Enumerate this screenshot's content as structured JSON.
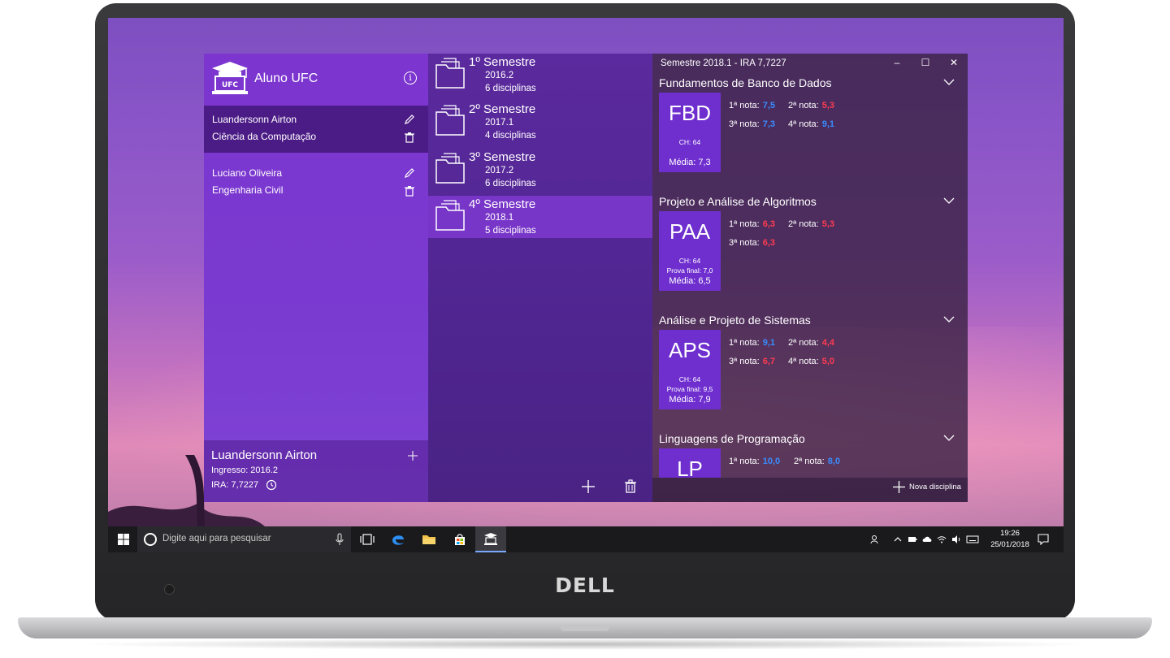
{
  "app": {
    "title": "Aluno UFC",
    "logo_text": "UFC"
  },
  "students": [
    {
      "name": "Luandersonn Airton",
      "course": "Ciência da Computação"
    },
    {
      "name": "Luciano Oliveira",
      "course": "Engenharia Civil"
    }
  ],
  "footer": {
    "name": "Luandersonn Airton",
    "ingresso": "Ingresso: 2016.2",
    "ira": "IRA: 7,7227"
  },
  "semesters": [
    {
      "title": "1º Semestre",
      "code": "2016.2",
      "count": "6 disciplinas"
    },
    {
      "title": "2º Semestre",
      "code": "2017.1",
      "count": "4 disciplinas"
    },
    {
      "title": "3º Semestre",
      "code": "2017.2",
      "count": "6 disciplinas"
    },
    {
      "title": "4º Semestre",
      "code": "2018.1",
      "count": "5 disciplinas"
    }
  ],
  "window": {
    "title": "Semestre 2018.1 - IRA 7,7227",
    "minimize": "–",
    "maximize": "☐",
    "close": "✕"
  },
  "disciplines": [
    {
      "title": "Fundamentos de Banco de Dados",
      "abbr": "FBD",
      "ch": "CH: 64",
      "final": "",
      "media": "Média: 7,3",
      "grades": [
        {
          "label": "1ª nota:",
          "value": "7,5",
          "color": "#3a8cff"
        },
        {
          "label": "2ª nota:",
          "value": "5,3",
          "color": "#ff3b52"
        },
        {
          "label": "3ª nota:",
          "value": "7,3",
          "color": "#3a8cff"
        },
        {
          "label": "4ª nota:",
          "value": "9,1",
          "color": "#3a8cff"
        }
      ]
    },
    {
      "title": "Projeto e Análise de Algoritmos",
      "abbr": "PAA",
      "ch": "CH: 64",
      "final": "Prova final: 7,0",
      "media": "Média: 6,5",
      "grades": [
        {
          "label": "1ª nota:",
          "value": "6,3",
          "color": "#ff3b52"
        },
        {
          "label": "2ª nota:",
          "value": "5,3",
          "color": "#ff3b52"
        },
        {
          "label": "3ª nota:",
          "value": "6,3",
          "color": "#ff3b52"
        }
      ]
    },
    {
      "title": "Análise e Projeto de Sistemas",
      "abbr": "APS",
      "ch": "CH: 64",
      "final": "Prova final: 9,5",
      "media": "Média: 7,9",
      "grades": [
        {
          "label": "1ª nota:",
          "value": "9,1",
          "color": "#3a8cff"
        },
        {
          "label": "2ª nota:",
          "value": "4,4",
          "color": "#ff3b52"
        },
        {
          "label": "3ª nota:",
          "value": "6,7",
          "color": "#ff3b52"
        },
        {
          "label": "4ª nota:",
          "value": "5,0",
          "color": "#ff3b52"
        }
      ]
    },
    {
      "title": "Linguagens de Programação",
      "abbr": "LP",
      "ch": "",
      "final": "",
      "media": "",
      "grades": [
        {
          "label": "1ª nota:",
          "value": "10,0",
          "color": "#3a8cff"
        },
        {
          "label": "2ª nota:",
          "value": "8,0",
          "color": "#3a8cff"
        }
      ]
    }
  ],
  "actions": {
    "new_discipline": "Nova disciplina"
  },
  "taskbar": {
    "search_placeholder": "Digite aqui para pesquisar",
    "time": "19:26",
    "date": "25/01/2018"
  },
  "device": {
    "brand": "DELL"
  },
  "colors": {
    "accent": "#7c35cf",
    "grade_good": "#3a8cff",
    "grade_bad": "#ff3b52"
  }
}
